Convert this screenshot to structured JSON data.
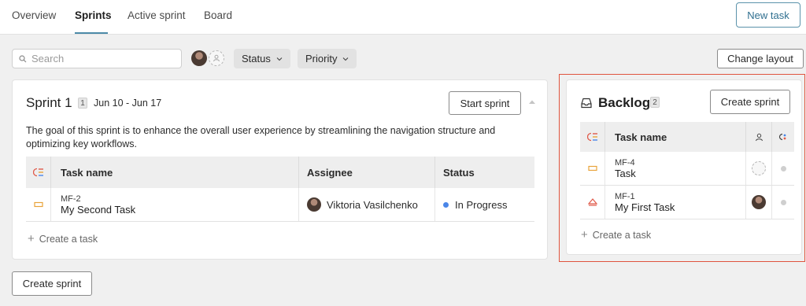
{
  "nav": {
    "tabs": [
      {
        "label": "Overview"
      },
      {
        "label": "Sprints"
      },
      {
        "label": "Active sprint"
      },
      {
        "label": "Board"
      }
    ],
    "new_task_label": "New task"
  },
  "toolbar": {
    "search_placeholder": "Search",
    "filters": [
      {
        "label": "Status"
      },
      {
        "label": "Priority"
      }
    ],
    "change_layout_label": "Change layout"
  },
  "sprint": {
    "title": "Sprint 1",
    "count": "1",
    "dates": "Jun 10 - Jun 17",
    "start_label": "Start sprint",
    "goal": "The goal of this sprint is to enhance the overall user experience by streamlining the navigation structure and optimizing key workflows.",
    "columns": {
      "task": "Task name",
      "assignee": "Assignee",
      "status": "Status"
    },
    "tasks": [
      {
        "key": "MF-2",
        "name": "My Second Task",
        "assignee": "Viktoria Vasilchenko",
        "status": "In Progress"
      }
    ],
    "add_task_label": "Create a task"
  },
  "backlog": {
    "title": "Backlog",
    "count": "2",
    "create_sprint_label": "Create sprint",
    "columns": {
      "task": "Task name"
    },
    "tasks": [
      {
        "key": "MF-4",
        "name": "Task"
      },
      {
        "key": "MF-1",
        "name": "My First Task"
      }
    ],
    "add_task_label": "Create a task"
  },
  "footer": {
    "create_sprint_label": "Create sprint"
  },
  "colors": {
    "accent": "#4c8aa8",
    "highlight_outline": "#e0543e",
    "status_in_progress": "#4a86e8",
    "priority_medium": "#e8a33a",
    "priority_high": "#e05a4a"
  }
}
